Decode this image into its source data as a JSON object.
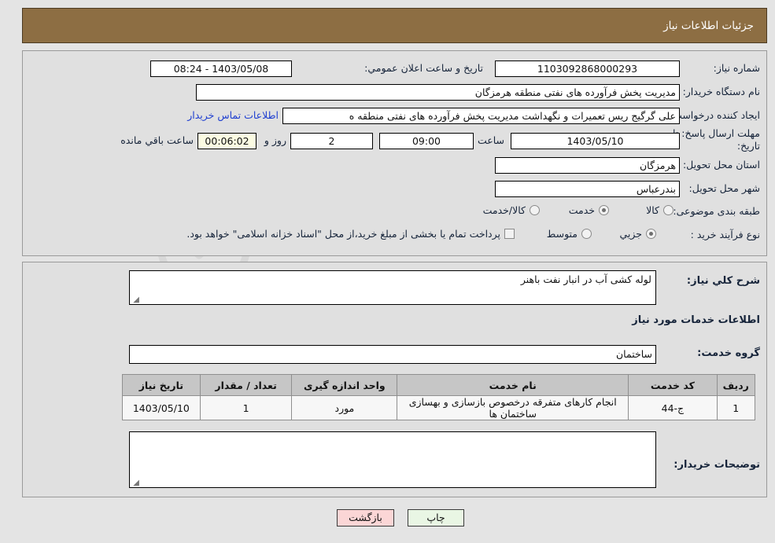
{
  "header": {
    "title": "جزئیات اطلاعات نیاز"
  },
  "top": {
    "need_number_label": "شماره نیاز:",
    "need_number_value": "1103092868000293",
    "announce_label": "تاریخ و ساعت اعلان عمومي:",
    "announce_value": "1403/05/08 - 08:24",
    "buyer_org_label": "نام دستگاه خریدار:",
    "buyer_org_value": "مدیریت پخش فرآورده های نفتی منطقه هرمزگان",
    "creator_label": "ایجاد کننده درخواست:",
    "creator_value": "علی گرگیج ریس تعمیرات و نگهداشت مدیریت پخش فرآورده های نفتی منطقه ه",
    "contact_link": "اطلاعات تماس خریدار",
    "deadline_label_line1": "مهلت ارسال پاسخ: تا",
    "deadline_label_line2": "تاریخ:",
    "deadline_date": "1403/05/10",
    "hour_label": "ساعت",
    "hour_value": "09:00",
    "days_value": "2",
    "days_and_label": "روز و",
    "countdown_value": "00:06:02",
    "countdown_label": "ساعت باقي مانده",
    "province_label": "استان محل تحویل:",
    "province_value": "هرمزگان",
    "city_label": "شهر محل تحویل:",
    "city_value": "بندرعباس",
    "category_label": "طبقه بندی موضوعی:",
    "category_options": [
      {
        "label": "کالا",
        "selected": false
      },
      {
        "label": "خدمت",
        "selected": true
      },
      {
        "label": "کالا/خدمت",
        "selected": false
      }
    ],
    "process_label": "نوع فرآیند خرید :",
    "process_options": [
      {
        "label": "جزیي",
        "selected": true
      },
      {
        "label": "متوسط",
        "selected": false
      }
    ],
    "treasury_checkbox_checked": false,
    "treasury_text": "پرداخت تمام یا بخشی از مبلغ خرید،از محل \"اسناد خزانه اسلامی\" خواهد بود."
  },
  "mid": {
    "general_desc_label": "شرح کلي نیاز:",
    "general_desc_value": "لوله کشی آب در انبار نفت باهنر",
    "services_info_heading": "اطلاعات خدمات مورد نیاز",
    "service_group_label": "گروه خدمت:",
    "service_group_value": "ساختمان",
    "buyer_notes_label": "توضیحات خریدار:",
    "buyer_notes_value": ""
  },
  "table": {
    "columns": [
      "ردیف",
      "کد خدمت",
      "نام خدمت",
      "واحد اندازه گیری",
      "تعداد / مقدار",
      "تاریخ نیاز"
    ],
    "rows": [
      {
        "row": "1",
        "code": "ج-44",
        "name": "انجام کارهای متفرقه درخصوص بازسازی و بهسازی ساختمان ها",
        "unit": "مورد",
        "qty": "1",
        "date": "1403/05/10"
      }
    ]
  },
  "footer": {
    "print_label": "چاپ",
    "back_label": "بازگشت"
  },
  "watermark": {
    "text_left": "Ana",
    "text_mid": "Tender",
    "text_right": ".net"
  },
  "colors": {
    "header_bg": "#8d6e43",
    "page_bg": "#e4e4e4",
    "panel_bg": "#e0e0e0",
    "link": "#1f3fd0",
    "table_header_bg": "#c6c6c6",
    "print_btn_bg": "#e9f6e4",
    "back_btn_bg": "#fbd6d6",
    "countdown_bg": "#fbfbe2"
  }
}
